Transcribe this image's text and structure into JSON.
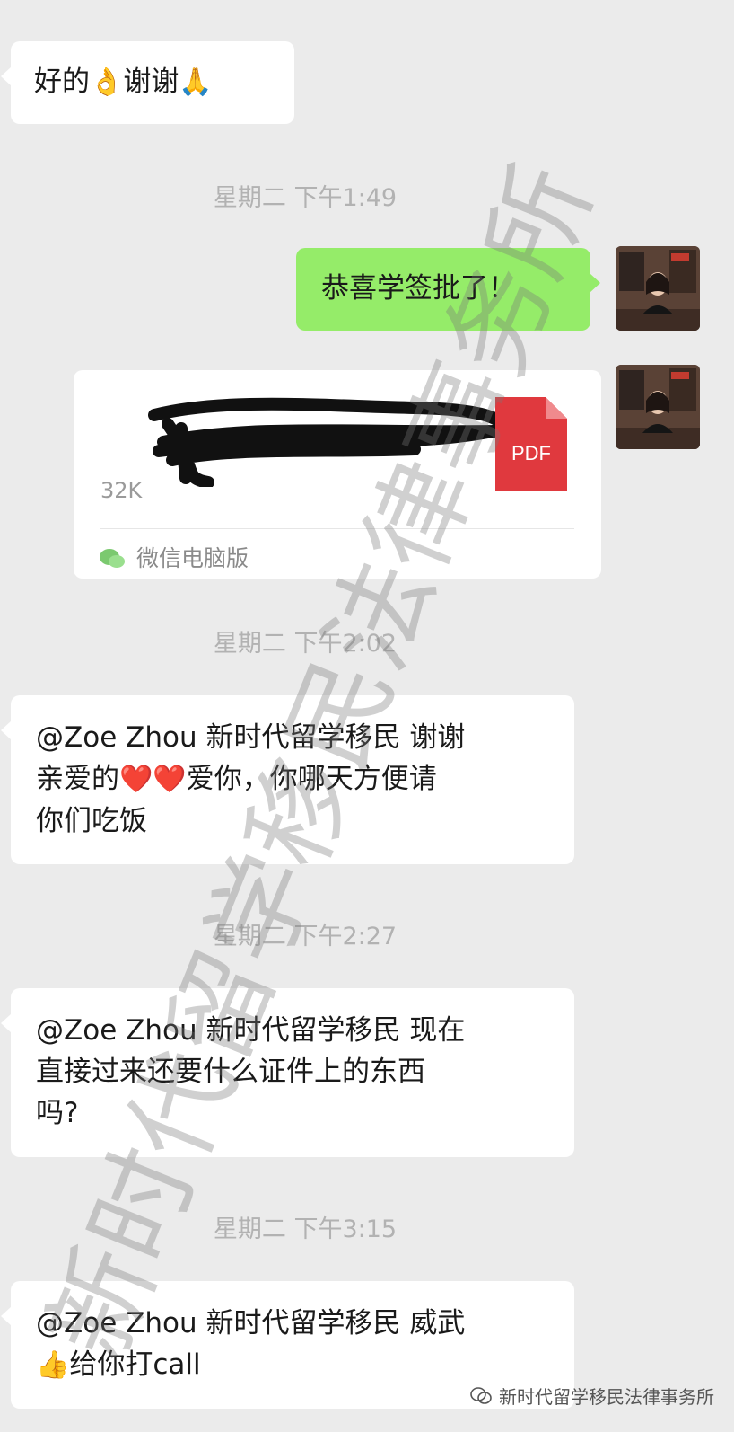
{
  "messages": [
    {
      "text": "好的",
      "emoji1": "👌",
      "text2": "谢谢",
      "emoji2": "🙏"
    },
    {
      "timestamp": "星期二 下午1:49"
    },
    {
      "sent_text": "恭喜学签批了！"
    },
    {
      "file": {
        "icon_label": "PDF",
        "size": "32K",
        "source": "微信电脑版"
      }
    },
    {
      "timestamp": "星期二 下午2:02"
    },
    {
      "line1": "@Zoe Zhou 新时代留学移民 谢谢",
      "line2_pre": "亲爱的",
      "line2_emoji": "❤️❤️",
      "line2_post": "爱你，你哪天方便请",
      "line3": "你们吃饭"
    },
    {
      "timestamp": "星期二 下午2:27"
    },
    {
      "line1": "@Zoe Zhou 新时代留学移民 现在",
      "line2": "直接过来还要什么证件上的东西",
      "line3": "吗?"
    },
    {
      "timestamp": "星期二 下午3:15"
    },
    {
      "line1": "@Zoe Zhou 新时代留学移民 威武",
      "line2_emoji": "👍",
      "line2": "给你打call"
    }
  ],
  "watermark": "新时代留学移民法律事务所",
  "footer": {
    "label": "新时代留学移民法律事务所"
  },
  "colors": {
    "sent_bubble": "#95ec69",
    "received_bubble": "#ffffff",
    "background": "#ebebeb",
    "pdf_red": "#e0393e"
  },
  "icons": [
    "pdf-icon",
    "wechat-icon",
    "avatar"
  ]
}
